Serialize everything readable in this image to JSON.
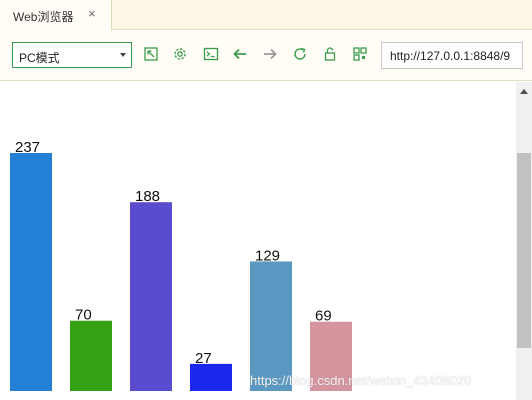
{
  "tab": {
    "title": "Web浏览器",
    "close_glyph": "×"
  },
  "toolbar": {
    "mode_select": {
      "value": "PC模式"
    },
    "icons": [
      "resize-icon",
      "settings-gear-icon",
      "console-icon",
      "back-arrow-icon",
      "forward-arrow-icon",
      "refresh-icon",
      "lock-icon",
      "qr-code-icon"
    ],
    "url": "http://127.0.0.1:8848/9"
  },
  "chart_data": {
    "type": "bar",
    "values": [
      237,
      70,
      188,
      27,
      129,
      69
    ],
    "colors": [
      "#2480d6",
      "#35a215",
      "#5a4ccf",
      "#1b27ee",
      "#5a98c2",
      "#d4959e"
    ],
    "ylim": [
      0,
      237
    ]
  },
  "watermark": "https://blog.csdn.net/weixin_43408020",
  "colors": {
    "accent": "#3a9c4c",
    "tab_bar_bg": "#fdf8e6"
  }
}
